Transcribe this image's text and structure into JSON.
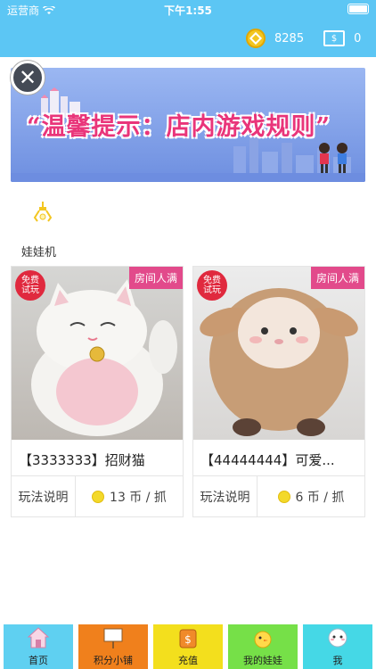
{
  "status_bar": {
    "carrier": "运营商",
    "time": "下午1:55"
  },
  "header": {
    "coins": "8285",
    "tickets": "0"
  },
  "banner": {
    "text": "“温馨提示：店内游戏规则”"
  },
  "section": {
    "title": "娃娃机"
  },
  "cards": [
    {
      "name": "【3333333】招财猫",
      "free_tag": "免费试玩",
      "room_tag": "房间人满",
      "rules": "玩法说明",
      "price": "13 币 / 抓"
    },
    {
      "name": "【44444444】可爱...",
      "free_tag": "免费试玩",
      "room_tag": "房间人满",
      "rules": "玩法说明",
      "price": "6 币 / 抓"
    }
  ],
  "tabs": [
    {
      "label": "首页",
      "color": "#5fd0f1"
    },
    {
      "label": "积分小铺",
      "color": "#f0801c"
    },
    {
      "label": "充值",
      "color": "#f3df1d"
    },
    {
      "label": "我的娃娃",
      "color": "#76e048"
    },
    {
      "label": "我",
      "color": "#45d8e6"
    }
  ]
}
